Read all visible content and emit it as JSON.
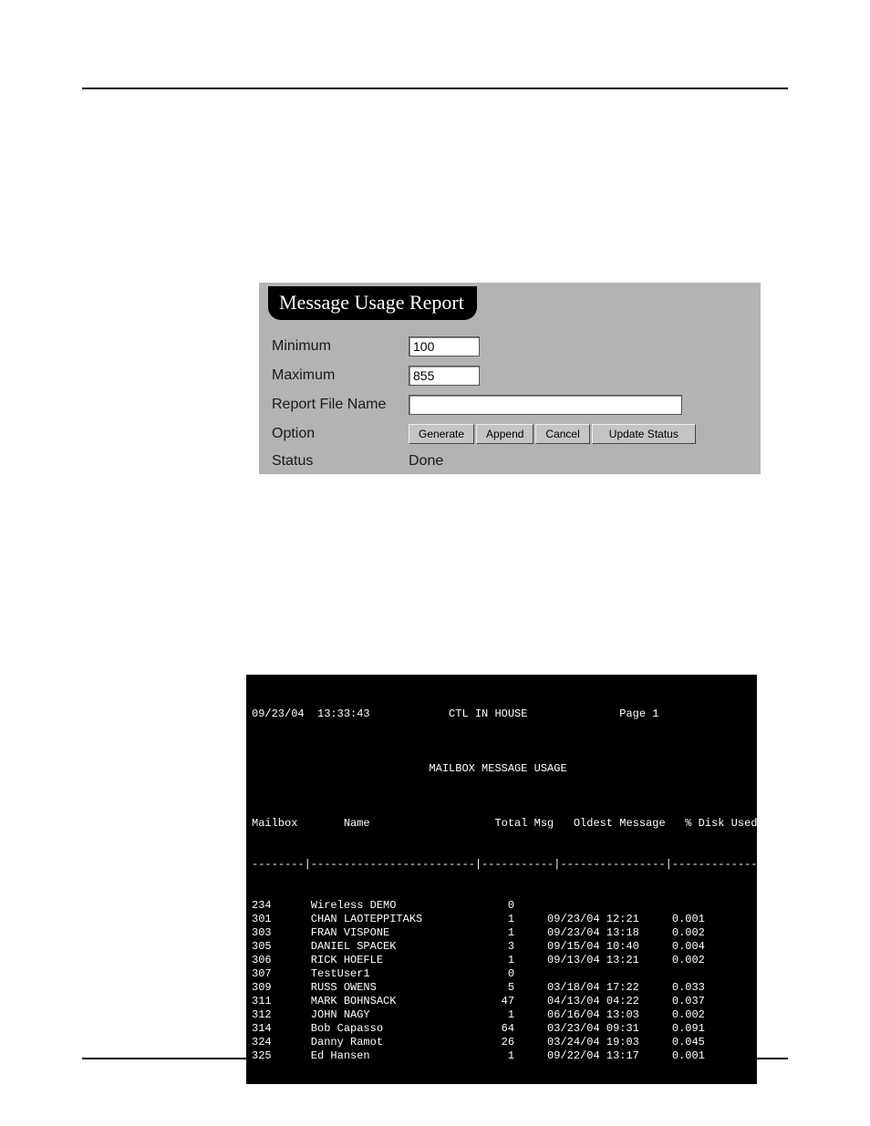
{
  "panel": {
    "title": "Message Usage Report",
    "labels": {
      "minimum": "Minimum",
      "maximum": "Maximum",
      "report_file_name": "Report File Name",
      "option": "Option",
      "status": "Status"
    },
    "values": {
      "minimum": "100",
      "maximum": "855",
      "report_file_name": "",
      "status": "Done"
    },
    "buttons": {
      "generate": "Generate",
      "append": "Append",
      "cancel": "Cancel",
      "update_status": "Update Status"
    }
  },
  "terminal": {
    "date": "09/23/04",
    "time": "13:33:43",
    "system": "CTL IN HOUSE",
    "page": "Page 1",
    "title": "MAILBOX MESSAGE USAGE",
    "columns": {
      "mailbox": "Mailbox",
      "name": "Name",
      "total_msg": "Total Msg",
      "oldest": "Oldest Message",
      "disk": "% Disk Used"
    },
    "separator": "--------|-------------------------|-----------|----------------|--------------",
    "rows": [
      {
        "mailbox": "234",
        "name": "Wireless DEMO",
        "total_msg": "0",
        "oldest": "",
        "disk": ""
      },
      {
        "mailbox": "301",
        "name": "CHAN LAOTEPPITAKS",
        "total_msg": "1",
        "oldest": "09/23/04 12:21",
        "disk": "0.001"
      },
      {
        "mailbox": "303",
        "name": "FRAN VISPONE",
        "total_msg": "1",
        "oldest": "09/23/04 13:18",
        "disk": "0.002"
      },
      {
        "mailbox": "305",
        "name": "DANIEL SPACEK",
        "total_msg": "3",
        "oldest": "09/15/04 10:40",
        "disk": "0.004"
      },
      {
        "mailbox": "306",
        "name": "RICK HOEFLE",
        "total_msg": "1",
        "oldest": "09/13/04 13:21",
        "disk": "0.002"
      },
      {
        "mailbox": "307",
        "name": "TestUser1",
        "total_msg": "0",
        "oldest": "",
        "disk": ""
      },
      {
        "mailbox": "309",
        "name": "RUSS OWENS",
        "total_msg": "5",
        "oldest": "03/18/04 17:22",
        "disk": "0.033"
      },
      {
        "mailbox": "311",
        "name": "MARK BOHNSACK",
        "total_msg": "47",
        "oldest": "04/13/04 04:22",
        "disk": "0.037"
      },
      {
        "mailbox": "312",
        "name": "JOHN NAGY",
        "total_msg": "1",
        "oldest": "06/16/04 13:03",
        "disk": "0.002"
      },
      {
        "mailbox": "314",
        "name": "Bob Capasso",
        "total_msg": "64",
        "oldest": "03/23/04 09:31",
        "disk": "0.091"
      },
      {
        "mailbox": "324",
        "name": "Danny Ramot",
        "total_msg": "26",
        "oldest": "03/24/04 19:03",
        "disk": "0.045"
      },
      {
        "mailbox": "325",
        "name": "Ed Hansen",
        "total_msg": "1",
        "oldest": "09/22/04 13:17",
        "disk": "0.001"
      }
    ]
  }
}
